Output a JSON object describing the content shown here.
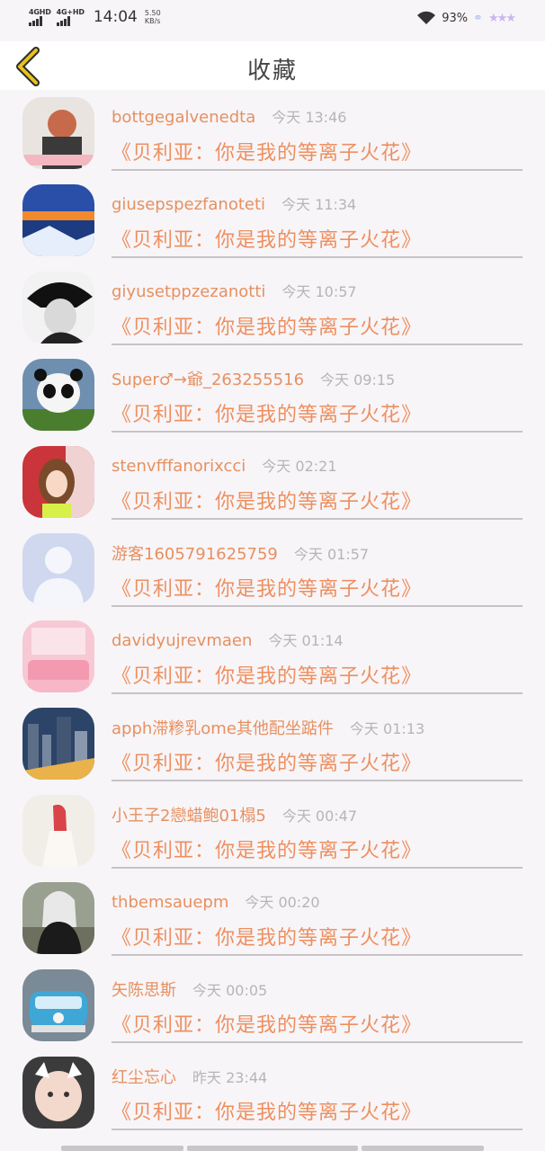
{
  "status_bar": {
    "signal1": "4GHD",
    "signal2": "4G+HD",
    "time": "14:04",
    "speed_value": "5.50",
    "speed_unit": "KB/s",
    "battery": "93%"
  },
  "header": {
    "title": "收藏",
    "back_icon": "chevron-left-icon"
  },
  "items": [
    {
      "name": "bottgegalvenedta",
      "time": "今天 13:46",
      "message": "《贝利亚：你是我的等离子火花》"
    },
    {
      "name": "giusepspezfanoteti",
      "time": "今天 11:34",
      "message": "《贝利亚：你是我的等离子火花》"
    },
    {
      "name": "giyusetppzezanotti",
      "time": "今天 10:57",
      "message": "《贝利亚：你是我的等离子火花》"
    },
    {
      "name": "Super♂→爺_263255516",
      "time": "今天 09:15",
      "message": "《贝利亚：你是我的等离子火花》"
    },
    {
      "name": "stenvfffanorixcci",
      "time": "今天 02:21",
      "message": "《贝利亚：你是我的等离子火花》"
    },
    {
      "name": "游客1605791625759",
      "time": "今天 01:57",
      "message": "《贝利亚：你是我的等离子火花》"
    },
    {
      "name": "davidyujrevmaen",
      "time": "今天 01:14",
      "message": "《贝利亚：你是我的等离子火花》"
    },
    {
      "name": "apph滞糁乳ome其他配坐踮件",
      "time": "今天 01:13",
      "message": "《贝利亚：你是我的等离子火花》"
    },
    {
      "name": "小王子2戀蜡鲍01榻5",
      "time": "今天 00:47",
      "message": "《贝利亚：你是我的等离子火花》"
    },
    {
      "name": "thbemsauepm",
      "time": "今天 00:20",
      "message": "《贝利亚：你是我的等离子火花》"
    },
    {
      "name": "矢陈思斯",
      "time": "今天 00:05",
      "message": "《贝利亚：你是我的等离子火花》"
    },
    {
      "name": "红尘忘心",
      "time": "昨天 23:44",
      "message": "《贝利亚：你是我的等离子火花》"
    }
  ],
  "colors": {
    "accent_text": "#ee8f5f",
    "timestamp": "#b8b3b8",
    "back_icon": "#e8c21e"
  }
}
